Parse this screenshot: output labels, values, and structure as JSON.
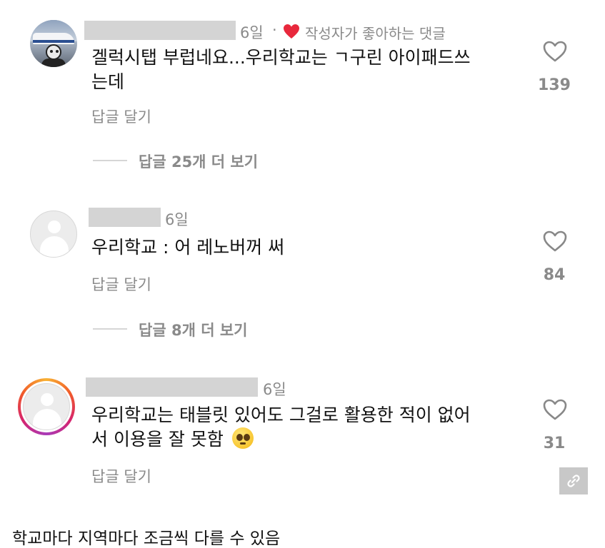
{
  "comments": [
    {
      "time": "6일",
      "liked_separator": "·",
      "liked_label": "작성자가 좋아하는 댓글",
      "text_line1": "겔럭시탭 부럽네요...우리학교는 ㄱ구린 아이패드쓰",
      "text_line2": "는데",
      "reply_label": "답글 달기",
      "view_replies": "답글 25개 더 보기",
      "like_count": "139",
      "avatar": "user-photo"
    },
    {
      "time": "6일",
      "text_line1": "우리학교 : 어 레노버꺼 써",
      "reply_label": "답글 달기",
      "view_replies": "답글 8개 더 보기",
      "like_count": "84",
      "avatar": "default-user-icon"
    },
    {
      "time": "6일",
      "text_line1": "우리학교는 태블릿 있어도 그걸로 활용한 적이 없어",
      "text_line2": "서 이용을 잘 못함",
      "emoji": "pleading-face-emoji",
      "reply_label": "답글 달기",
      "like_count": "31",
      "avatar": "default-user-icon-story-ring"
    }
  ],
  "caption": "학교마다 지역마다 조금씩 다를 수 있음",
  "icons": {
    "like": "heart-outline-icon",
    "liked_by_author": "heart-filled-icon",
    "link": "link-icon"
  },
  "colors": {
    "heart_red": "#e8283c",
    "muted_text": "#8a8a8a",
    "name_placeholder": "#d4d4d4"
  }
}
